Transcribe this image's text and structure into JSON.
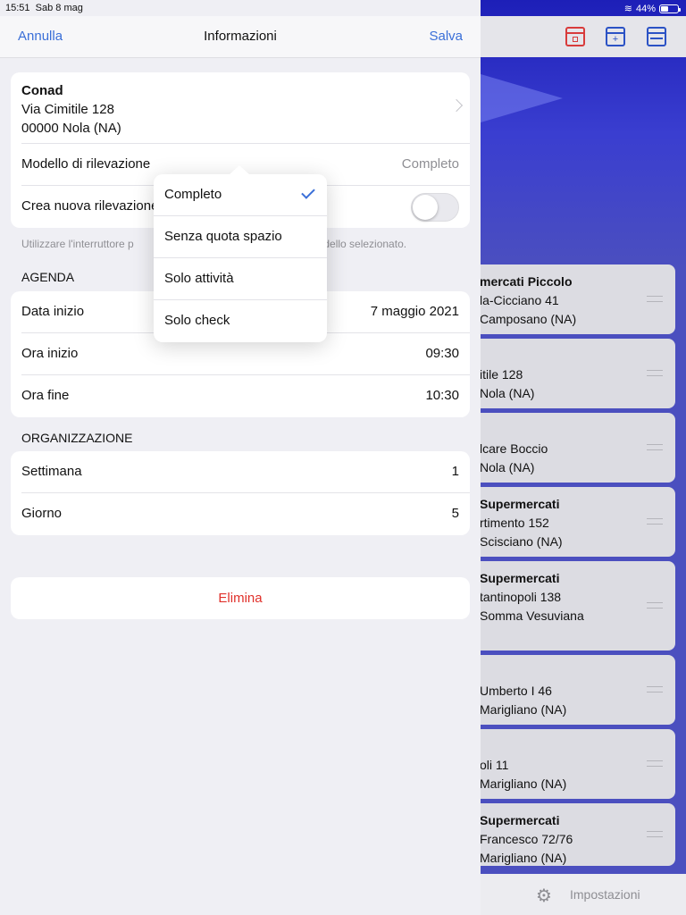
{
  "status_bar": {
    "time": "15:51",
    "date": "Sab 8 mag",
    "battery": "44%",
    "battery_level": 0.44
  },
  "nav": {
    "cancel_label": "Annulla",
    "title": "Informazioni",
    "save_label": "Salva"
  },
  "store": {
    "name": "Conad",
    "address": "Via Cimitile 128",
    "city": "00000 Nola (NA)"
  },
  "survey_model": {
    "label": "Modello di rilevazione",
    "value": "Completo"
  },
  "new_survey": {
    "label": "Crea nuova rilevazione",
    "enabled": false
  },
  "footnote": {
    "left": "Utilizzare l'interruttore p",
    "right": "modello selezionato."
  },
  "agenda": {
    "header": "AGENDA",
    "start_date_label": "Data inizio",
    "start_date": "7 maggio 2021",
    "start_time_label": "Ora inizio",
    "start_time": "09:30",
    "end_time_label": "Ora fine",
    "end_time": "10:30"
  },
  "organization": {
    "header": "ORGANIZZAZIONE",
    "week_label": "Settimana",
    "week": "1",
    "day_label": "Giorno",
    "day": "5"
  },
  "delete_label": "Elimina",
  "popover": {
    "options": [
      "Completo",
      "Senza quota spazio",
      "Solo attività",
      "Solo check"
    ],
    "selected_index": 0
  },
  "background": {
    "cards": [
      {
        "l1": "mercati Piccolo",
        "l2": "la-Cicciano 41",
        "l3": "Camposano (NA)",
        "bold": true
      },
      {
        "l1": "",
        "l2": "itile 128",
        "l3": "Nola (NA)",
        "bold": false
      },
      {
        "l1": "",
        "l2": "lcare Boccio",
        "l3": "Nola (NA)",
        "bold": false
      },
      {
        "l1": "Supermercati",
        "l2": "rtimento 152",
        "l3": "Scisciano (NA)",
        "bold": true
      },
      {
        "l1": "Supermercati",
        "l2": "tantinopoli 138",
        "l3": "Somma Vesuviana",
        "bold": true
      },
      {
        "l1": "",
        "l2": "Umberto I 46",
        "l3": "Marigliano (NA)",
        "bold": false
      },
      {
        "l1": "",
        "l2": "oli 11",
        "l3": "Marigliano (NA)",
        "bold": false
      },
      {
        "l1": "Supermercati",
        "l2": "Francesco 72/76",
        "l3": "Marigliano (NA)",
        "bold": true
      }
    ],
    "tab_label": "Impostazioni",
    "colors": {
      "accent": "#3a6fd8",
      "destructive": "#e0302a",
      "bg_blue": "#4b4fbf"
    }
  }
}
